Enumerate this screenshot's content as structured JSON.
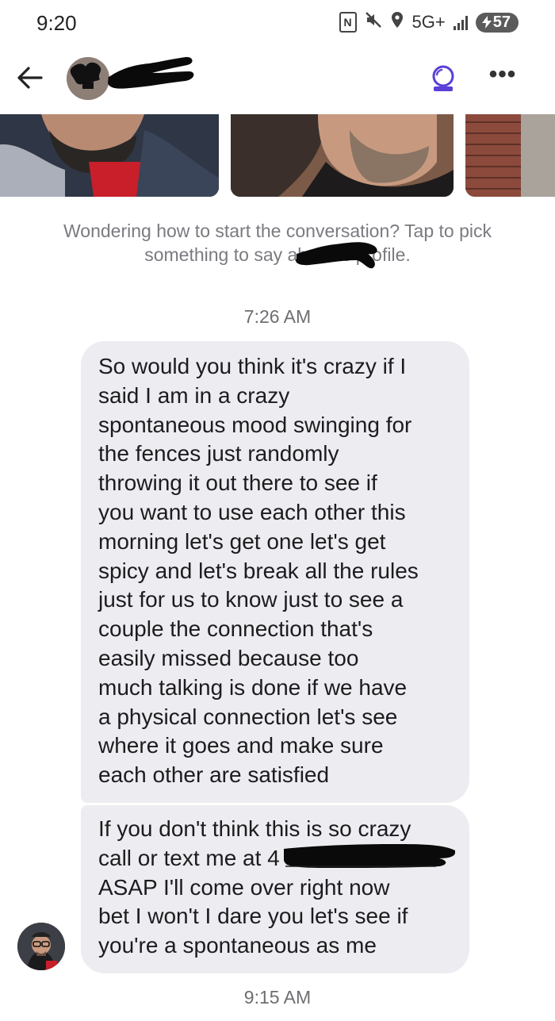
{
  "status_bar": {
    "time": "9:20",
    "network": "5G+",
    "battery": "57"
  },
  "header": {
    "back_icon": "back-arrow-icon",
    "ai_icon": "crystal-ball-icon",
    "more_icon": "more-dots-icon",
    "more_label": "•••"
  },
  "prompt": {
    "text": "Wondering how to start the conversation? Tap to pick something to say about        's profile."
  },
  "conversation": {
    "timestamp_1": "7:26 AM",
    "message_1": "So would you think it's crazy if I\nsaid I am in a crazy\nspontaneous mood swinging for\nthe fences just randomly\nthrowing it out there to see if\nyou want to use each other this\nmorning let's get one let's get\nspicy and let's break all the rules\njust for us to know just to see a\ncouple the connection that's\neasily missed because too\nmuch talking is done if we have\na physical connection let's see\nwhere it goes and make sure\neach other are satisfied",
    "message_2": "If you don't think this is so crazy\ncall or text me at 4\nASAP I'll come over right now\nbet I won't I dare you let's see if\nyou're a spontaneous as me",
    "timestamp_2": "9:15 AM"
  },
  "colors": {
    "bubble": "#ededf1",
    "accent": "#5b3fd6",
    "muted_text": "#7a7a80"
  }
}
